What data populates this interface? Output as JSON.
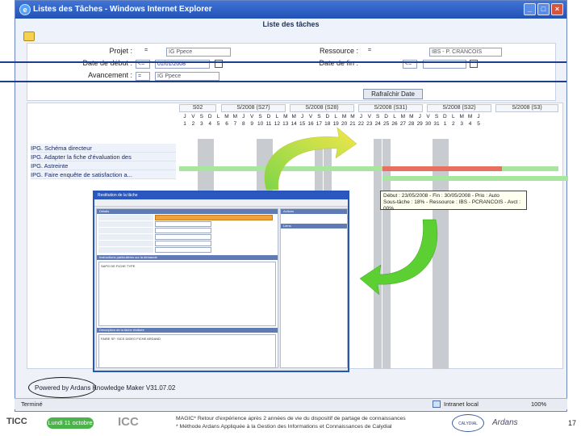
{
  "window": {
    "title": "Listes des Tâches - Windows Internet Explorer",
    "app_title": "Liste des tâches"
  },
  "filters": {
    "projet_label": "Projet :",
    "projet_value": "IG Ppece",
    "date_debut_label": "Date de début :",
    "date_debut_value": "01/01/2008",
    "avancement_label": "Avancement :",
    "avancement_value": "IG Ppece",
    "ressource_label": "Ressource :",
    "ressource_value": "IBS - P. CRANCOIS",
    "date_fin_label": "Date de fin :",
    "refresh_button": "Rafraîchir Date",
    "operator": "=",
    "operator2": "<="
  },
  "gantt": {
    "weeks": [
      "S02",
      "S/2008 (S27)",
      "S/2008 (S28)",
      "S/2008 (S31)",
      "S/2008 (S32)",
      "S/2008 (S3)"
    ],
    "day_letters": [
      "J",
      "V",
      "S",
      "D",
      "L",
      "M",
      "M",
      "J",
      "V",
      "S",
      "D",
      "L",
      "M",
      "M",
      "J",
      "V",
      "S",
      "D",
      "L",
      "M",
      "M",
      "J",
      "V",
      "S",
      "D",
      "L",
      "M",
      "M",
      "J",
      "V",
      "S",
      "D",
      "L",
      "M",
      "M",
      "J"
    ],
    "day_numbers": [
      "1",
      "2",
      "3",
      "4",
      "5",
      "6",
      "7",
      "8",
      "9",
      "10",
      "11",
      "12",
      "13",
      "14",
      "15",
      "16",
      "17",
      "18",
      "19",
      "20",
      "21",
      "22",
      "23",
      "24",
      "25",
      "26",
      "27",
      "28",
      "29",
      "30",
      "31",
      "1",
      "2",
      "3",
      "4",
      "5",
      "6"
    ],
    "tasks": [
      "IPG. Schéma directeur",
      "IPG. Adapter la fiche d'évaluation des",
      "IPG. Astreinte",
      "IPG. Faire enquête de satisfaction a..."
    ]
  },
  "popup": {
    "title": "Restitution de la tâche",
    "section1": "Détails",
    "section2": "Instructions particulières sur la demande",
    "section2_text": "SAPG DE FICHE TYPE",
    "section3": "Description de la tâche réalisée",
    "section3_text": "FAIRE SF: SICS DIDEO FICHE ARDAND",
    "side1": "Actions",
    "side2": "Liens"
  },
  "tooltip": {
    "line1": "Début : 23/05/2008 - Fin : 30/05/2008 - Prio : Auto",
    "line2": "Sous-tâche : 18% - Ressource : IBS - PCRANCOIS - Avct : 00%"
  },
  "status": {
    "powered": "Powered by Ardans Knowledge Maker V31.07.02",
    "done": "Terminé",
    "zone": "Intranet local",
    "zoom": "100%"
  },
  "footer": {
    "lundi": "Lundi 11 octobre",
    "icc": "ICC",
    "ticc": "TICC",
    "line1": "MAGIC* Retour d'expérience après 2 années de vie du dispositif de partage de connaissances",
    "line2": "* Méthode Ardans Appliquée à la Gestion des Informations et Connaissances de Calydial",
    "callydial": "CALYDIAL",
    "ardans": "Ardans",
    "page": "17"
  }
}
